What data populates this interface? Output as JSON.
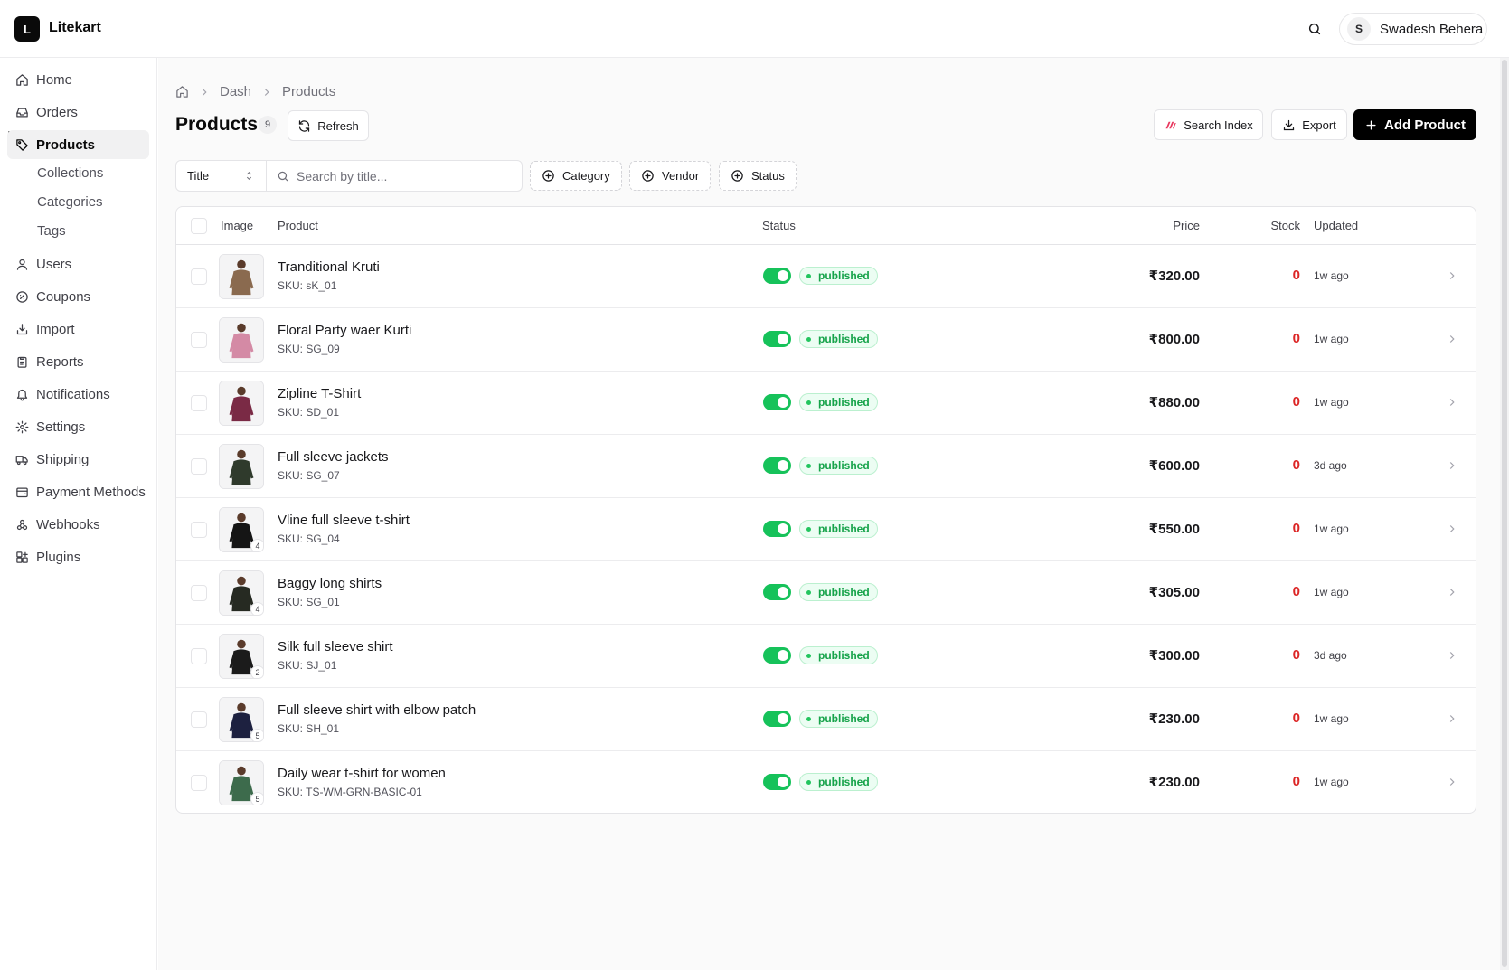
{
  "app": {
    "logo_letter": "L",
    "name": "Litekart"
  },
  "header": {
    "user_initial": "S",
    "user_name": "Swadesh Behera"
  },
  "sidebar": {
    "items": [
      {
        "label": "Home",
        "icon": "home-icon"
      },
      {
        "label": "Orders",
        "icon": "inbox-icon"
      },
      {
        "label": "Products",
        "icon": "tag-icon",
        "active": true
      },
      {
        "label": "Users",
        "icon": "user-icon"
      },
      {
        "label": "Coupons",
        "icon": "coupon-icon"
      },
      {
        "label": "Import",
        "icon": "import-icon"
      },
      {
        "label": "Reports",
        "icon": "clipboard-icon"
      },
      {
        "label": "Notifications",
        "icon": "bell-icon"
      },
      {
        "label": "Settings",
        "icon": "gear-icon"
      },
      {
        "label": "Shipping",
        "icon": "truck-icon"
      },
      {
        "label": "Payment Methods",
        "icon": "wallet-icon"
      },
      {
        "label": "Webhooks",
        "icon": "webhook-icon"
      },
      {
        "label": "Plugins",
        "icon": "blocks-icon"
      }
    ],
    "product_subitems": [
      "Collections",
      "Categories",
      "Tags"
    ]
  },
  "breadcrumb": [
    "Dash",
    "Products"
  ],
  "page": {
    "title": "Products",
    "count": "9",
    "refresh_label": "Refresh",
    "search_index_label": "Search Index",
    "export_label": "Export",
    "add_label": "Add Product"
  },
  "filters": {
    "field_select": "Title",
    "search_placeholder": "Search by title...",
    "category_label": "Category",
    "vendor_label": "Vendor",
    "status_label": "Status"
  },
  "table": {
    "columns": {
      "image": "Image",
      "product": "Product",
      "status": "Status",
      "price": "Price",
      "stock": "Stock",
      "updated": "Updated"
    },
    "rows": [
      {
        "name": "Tranditional Kruti",
        "sku": "SKU: sK_01",
        "status": "published",
        "price": "₹320.00",
        "stock": "0",
        "updated": "1w ago",
        "images": "",
        "color": "#8a6a4f"
      },
      {
        "name": "Floral Party waer Kurti",
        "sku": "SKU: SG_09",
        "status": "published",
        "price": "₹800.00",
        "stock": "0",
        "updated": "1w ago",
        "images": "",
        "color": "#d48aa5"
      },
      {
        "name": "Zipline T-Shirt",
        "sku": "SKU: SD_01",
        "status": "published",
        "price": "₹880.00",
        "stock": "0",
        "updated": "1w ago",
        "images": "",
        "color": "#7a2a45"
      },
      {
        "name": "Full sleeve jackets",
        "sku": "SKU: SG_07",
        "status": "published",
        "price": "₹600.00",
        "stock": "0",
        "updated": "3d ago",
        "images": "",
        "color": "#2f3a2c"
      },
      {
        "name": "Vline full sleeve t-shirt",
        "sku": "SKU: SG_04",
        "status": "published",
        "price": "₹550.00",
        "stock": "0",
        "updated": "1w ago",
        "images": "4",
        "color": "#151515"
      },
      {
        "name": "Baggy long shirts",
        "sku": "SKU: SG_01",
        "status": "published",
        "price": "₹305.00",
        "stock": "0",
        "updated": "1w ago",
        "images": "4",
        "color": "#262a22"
      },
      {
        "name": "Silk full sleeve shirt",
        "sku": "SKU: SJ_01",
        "status": "published",
        "price": "₹300.00",
        "stock": "0",
        "updated": "3d ago",
        "images": "2",
        "color": "#1b1b1b"
      },
      {
        "name": "Full sleeve shirt with elbow patch",
        "sku": "SKU: SH_01",
        "status": "published",
        "price": "₹230.00",
        "stock": "0",
        "updated": "1w ago",
        "images": "5",
        "color": "#1d2140"
      },
      {
        "name": "Daily wear t-shirt for women",
        "sku": "SKU: TS-WM-GRN-BASIC-01",
        "status": "published",
        "price": "₹230.00",
        "stock": "0",
        "updated": "1w ago",
        "images": "5",
        "color": "#3d6b4c"
      }
    ]
  },
  "colors": {
    "accent": "#000000",
    "success": "#16c25a",
    "danger": "#dc2626",
    "search_index_brand": "#e8365d"
  }
}
